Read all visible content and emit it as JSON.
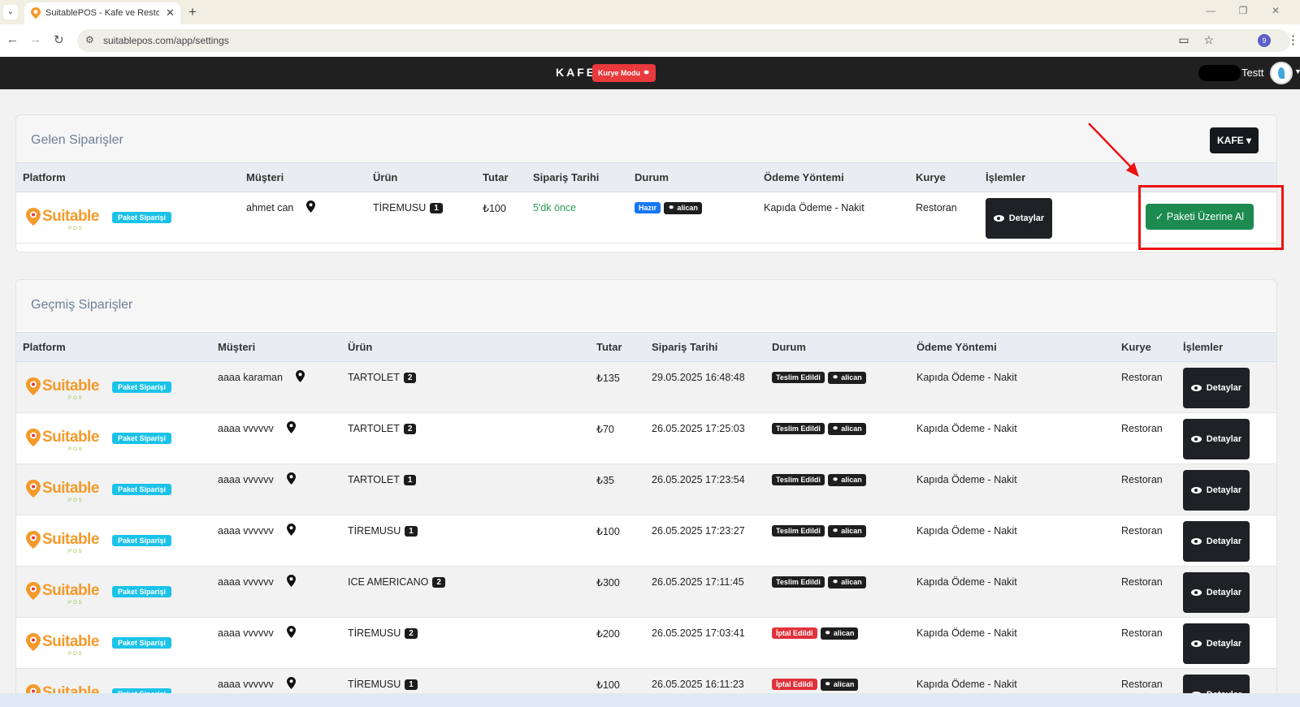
{
  "browser": {
    "tab_title": "SuitablePOS - Kafe ve Restoran",
    "url": "suitablepos.com/app/settings",
    "profile_initial": "9"
  },
  "header": {
    "brand": "KAFE",
    "mode_badge": "Kurye Modu",
    "username": "Testt"
  },
  "incoming": {
    "title": "Gelen Siparişler",
    "filter_label": "KAFE",
    "columns": [
      "Platform",
      "Müşteri",
      "Ürün",
      "Tutar",
      "Sipariş Tarihi",
      "Durum",
      "Ödeme Yöntemi",
      "Kurye",
      "İşlemler"
    ],
    "rows": [
      {
        "platform_logo": "Suitable",
        "platform_sub": "POS",
        "type_badge": "Paket Siparişi",
        "customer": "ahmet can",
        "product": "TİREMUSU",
        "qty": "1",
        "amount": "₺100",
        "date": "5'dk önce",
        "status": "Hazır",
        "courier_badge": "alican",
        "payment": "Kapıda Ödeme - Nakit",
        "courier": "Restoran",
        "details_label": "Detaylar",
        "take_label": "Paketi Üzerine Al"
      }
    ]
  },
  "history": {
    "title": "Geçmiş Siparişler",
    "columns": [
      "Platform",
      "Müşteri",
      "Ürün",
      "Tutar",
      "Sipariş Tarihi",
      "Durum",
      "Ödeme Yöntemi",
      "Kurye",
      "İşlemler"
    ],
    "rows": [
      {
        "platform_logo": "Suitable",
        "platform_sub": "POS",
        "type_badge": "Paket Siparişi",
        "customer": "aaaa karaman",
        "product": "TARTOLET",
        "qty": "2",
        "amount": "₺135",
        "date": "29.05.2025 16:48:48",
        "status": "Teslim Edildi",
        "status_color": "#1e1e1e",
        "courier_badge": "alican",
        "payment": "Kapıda Ödeme - Nakit",
        "courier": "Restoran",
        "details_label": "Detaylar"
      },
      {
        "platform_logo": "Suitable",
        "platform_sub": "POS",
        "type_badge": "Paket Siparişi",
        "customer": "aaaa vvvvvv",
        "product": "TARTOLET",
        "qty": "2",
        "amount": "₺70",
        "date": "26.05.2025 17:25:03",
        "status": "Teslim Edildi",
        "status_color": "#1e1e1e",
        "courier_badge": "alican",
        "payment": "Kapıda Ödeme - Nakit",
        "courier": "Restoran",
        "details_label": "Detaylar"
      },
      {
        "platform_logo": "Suitable",
        "platform_sub": "POS",
        "type_badge": "Paket Siparişi",
        "customer": "aaaa vvvvvv",
        "product": "TARTOLET",
        "qty": "1",
        "amount": "₺35",
        "date": "26.05.2025 17:23:54",
        "status": "Teslim Edildi",
        "status_color": "#1e1e1e",
        "courier_badge": "alican",
        "payment": "Kapıda Ödeme - Nakit",
        "courier": "Restoran",
        "details_label": "Detaylar"
      },
      {
        "platform_logo": "Suitable",
        "platform_sub": "POS",
        "type_badge": "Paket Siparişi",
        "customer": "aaaa vvvvvv",
        "product": "TİREMUSU",
        "qty": "1",
        "amount": "₺100",
        "date": "26.05.2025 17:23:27",
        "status": "Teslim Edildi",
        "status_color": "#1e1e1e",
        "courier_badge": "alican",
        "payment": "Kapıda Ödeme - Nakit",
        "courier": "Restoran",
        "details_label": "Detaylar"
      },
      {
        "platform_logo": "Suitable",
        "platform_sub": "POS",
        "type_badge": "Paket Siparişi",
        "customer": "aaaa vvvvvv",
        "product": "ICE AMERICANO",
        "qty": "2",
        "amount": "₺300",
        "date": "26.05.2025 17:11:45",
        "status": "Teslim Edildi",
        "status_color": "#1e1e1e",
        "courier_badge": "alican",
        "payment": "Kapıda Ödeme - Nakit",
        "courier": "Restoran",
        "details_label": "Detaylar"
      },
      {
        "platform_logo": "Suitable",
        "platform_sub": "POS",
        "type_badge": "Paket Siparişi",
        "customer": "aaaa vvvvvv",
        "product": "TİREMUSU",
        "qty": "2",
        "amount": "₺200",
        "date": "26.05.2025 17:03:41",
        "status": "İptal Edildi",
        "status_color": "#e0323a",
        "courier_badge": "alican",
        "payment": "Kapıda Ödeme - Nakit",
        "courier": "Restoran",
        "details_label": "Detaylar"
      },
      {
        "platform_logo": "Suitable",
        "platform_sub": "POS",
        "type_badge": "Paket Siparişi",
        "customer": "aaaa vvvvvv",
        "product": "TİREMUSU",
        "qty": "1",
        "amount": "₺100",
        "date": "26.05.2025 16:11:23",
        "status": "İptal Edildi",
        "status_color": "#e0323a",
        "courier_badge": "alican",
        "payment": "Kapıda Ödeme - Nakit",
        "courier": "Restoran",
        "details_label": "Detaylar"
      }
    ]
  },
  "colors": {
    "header_bg": "#202020",
    "badge_red": "#e8393d",
    "paket_badge": "#1bc2e8",
    "ready_blue": "#1877f2",
    "take_green": "#1d8a4f",
    "highlight_red": "#ee1111"
  }
}
